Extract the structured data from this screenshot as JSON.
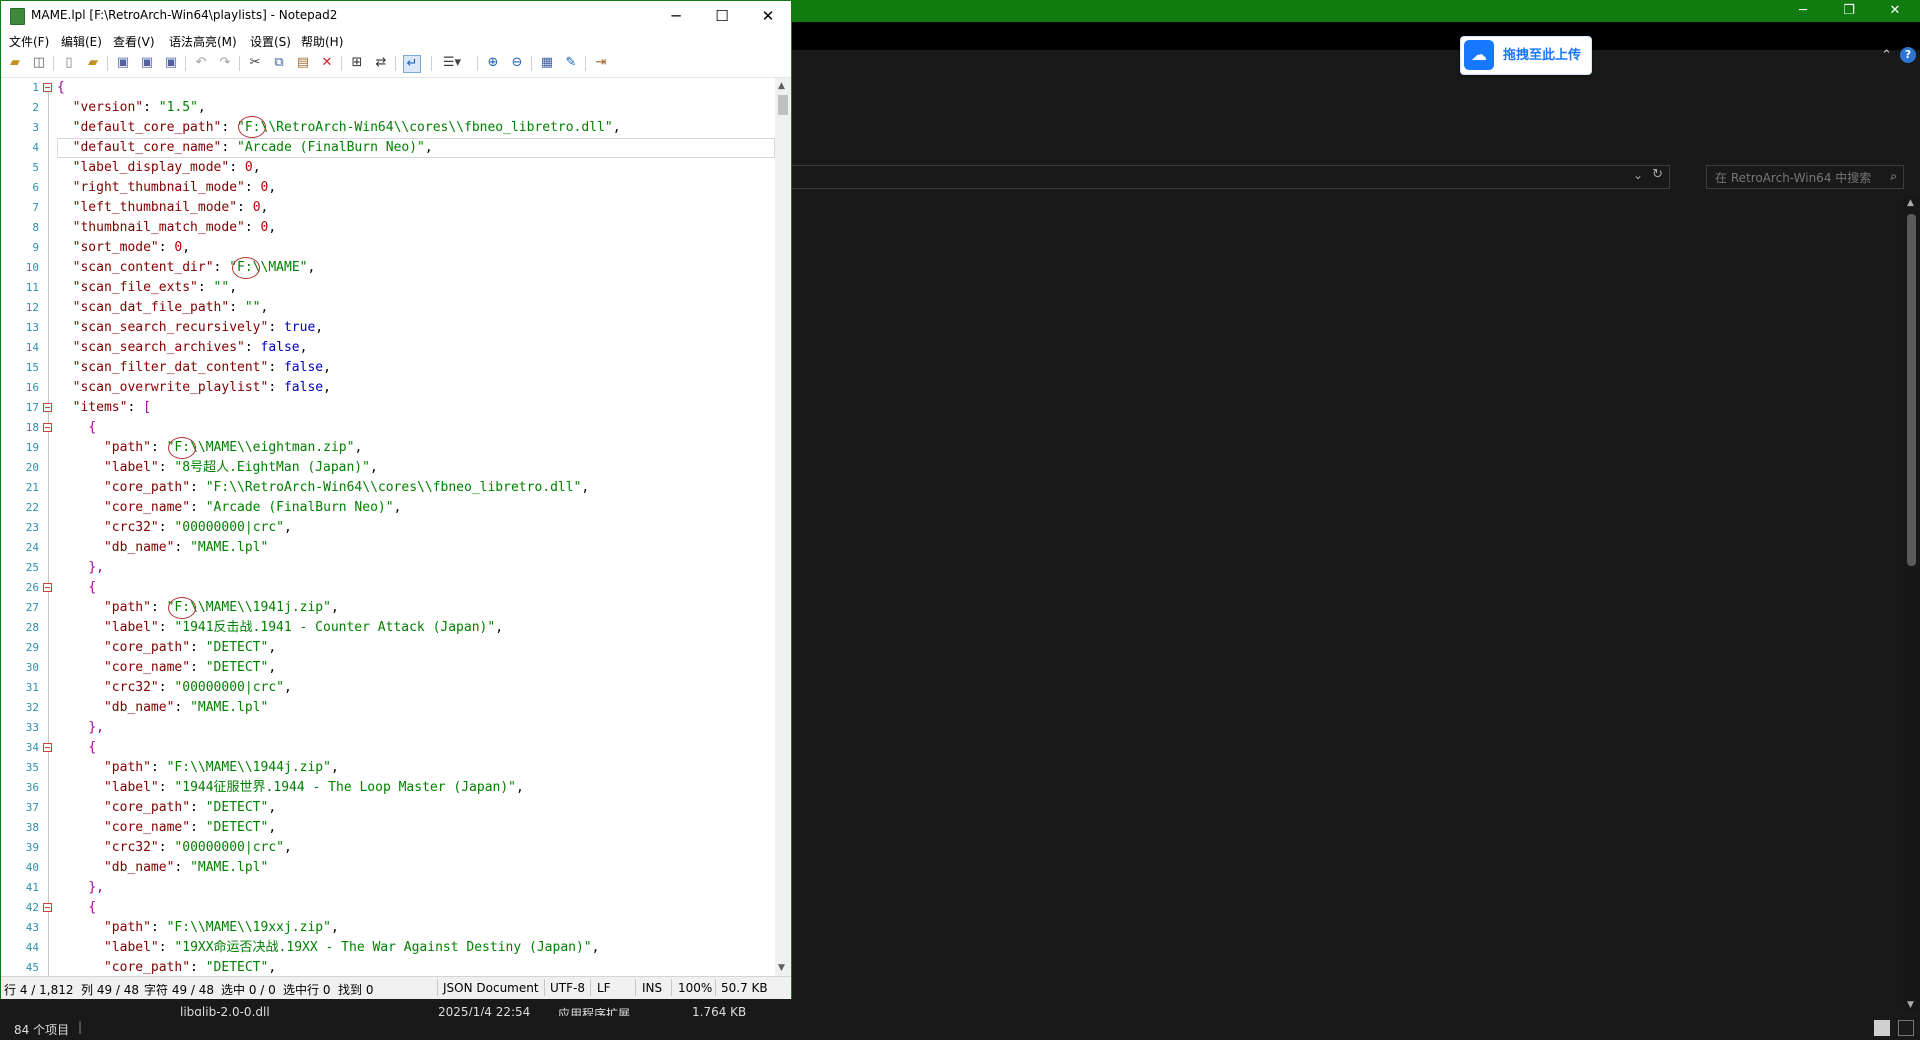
{
  "explorer": {
    "search_placeholder": "在 RetroArch-Win64 中搜索",
    "cloud_upload_label": "拖拽至此上传",
    "help_label": "?",
    "row": {
      "name": "libglib-2.0-0.dll",
      "modified": "2025/1/4 22:54",
      "type": "应用程序扩展",
      "size": "1,764 KB"
    },
    "status": {
      "item_count": "84 个项目",
      "separator": "|"
    }
  },
  "notepad": {
    "title": "MAME.lpl [F:\\RetroArch-Win64\\playlists] - Notepad2",
    "menu": [
      "文件(F)",
      "编辑(E)",
      "查看(V)",
      "语法高亮(M)",
      "设置(S)",
      "帮助(H)"
    ],
    "status": {
      "position": "行 4 / 1,812",
      "column": "列 49 / 48",
      "char": "字符 49 / 48",
      "selection": "选中 0 / 0",
      "selected_lines": "选中行 0",
      "find": "找到 0",
      "syntax": "JSON Document",
      "encoding": "UTF-8",
      "eol": "LF",
      "mode": "INS",
      "zoom": "100%",
      "size": "50.7 KB"
    },
    "lines": [
      {
        "n": "1",
        "t": [
          [
            "br",
            "{"
          ]
        ]
      },
      {
        "n": "2",
        "t": [
          [
            "p",
            "  "
          ],
          [
            "k",
            "\"version\""
          ],
          [
            "p",
            ": "
          ],
          [
            "s",
            "\"1.5\""
          ],
          [
            "p",
            ","
          ]
        ]
      },
      {
        "n": "3",
        "t": [
          [
            "p",
            "  "
          ],
          [
            "k",
            "\"default_core_path\""
          ],
          [
            "p",
            ": "
          ],
          [
            "s",
            "\"F:\\\\RetroArch-Win64\\\\cores\\\\fbneo_libretro.dll\""
          ],
          [
            "p",
            ","
          ]
        ]
      },
      {
        "n": "4",
        "t": [
          [
            "p",
            "  "
          ],
          [
            "k",
            "\"default_core_name\""
          ],
          [
            "p",
            ": "
          ],
          [
            "s",
            "\"Arcade (FinalBurn Neo)\""
          ],
          [
            "p",
            ","
          ]
        ]
      },
      {
        "n": "5",
        "t": [
          [
            "p",
            "  "
          ],
          [
            "k",
            "\"label_display_mode\""
          ],
          [
            "p",
            ": "
          ],
          [
            "n",
            "0"
          ],
          [
            "p",
            ","
          ]
        ]
      },
      {
        "n": "6",
        "t": [
          [
            "p",
            "  "
          ],
          [
            "k",
            "\"right_thumbnail_mode\""
          ],
          [
            "p",
            ": "
          ],
          [
            "n",
            "0"
          ],
          [
            "p",
            ","
          ]
        ]
      },
      {
        "n": "7",
        "t": [
          [
            "p",
            "  "
          ],
          [
            "k",
            "\"left_thumbnail_mode\""
          ],
          [
            "p",
            ": "
          ],
          [
            "n",
            "0"
          ],
          [
            "p",
            ","
          ]
        ]
      },
      {
        "n": "8",
        "t": [
          [
            "p",
            "  "
          ],
          [
            "k",
            "\"thumbnail_match_mode\""
          ],
          [
            "p",
            ": "
          ],
          [
            "n",
            "0"
          ],
          [
            "p",
            ","
          ]
        ]
      },
      {
        "n": "9",
        "t": [
          [
            "p",
            "  "
          ],
          [
            "k",
            "\"sort_mode\""
          ],
          [
            "p",
            ": "
          ],
          [
            "n",
            "0"
          ],
          [
            "p",
            ","
          ]
        ]
      },
      {
        "n": "10",
        "t": [
          [
            "p",
            "  "
          ],
          [
            "k",
            "\"scan_content_dir\""
          ],
          [
            "p",
            ": "
          ],
          [
            "s",
            "\"F:\\\\MAME\""
          ],
          [
            "p",
            ","
          ]
        ]
      },
      {
        "n": "11",
        "t": [
          [
            "p",
            "  "
          ],
          [
            "k",
            "\"scan_file_exts\""
          ],
          [
            "p",
            ": "
          ],
          [
            "s",
            "\"\""
          ],
          [
            "p",
            ","
          ]
        ]
      },
      {
        "n": "12",
        "t": [
          [
            "p",
            "  "
          ],
          [
            "k",
            "\"scan_dat_file_path\""
          ],
          [
            "p",
            ": "
          ],
          [
            "s",
            "\"\""
          ],
          [
            "p",
            ","
          ]
        ]
      },
      {
        "n": "13",
        "t": [
          [
            "p",
            "  "
          ],
          [
            "k",
            "\"scan_search_recursively\""
          ],
          [
            "p",
            ": "
          ],
          [
            "b",
            "true"
          ],
          [
            "p",
            ","
          ]
        ]
      },
      {
        "n": "14",
        "t": [
          [
            "p",
            "  "
          ],
          [
            "k",
            "\"scan_search_archives\""
          ],
          [
            "p",
            ": "
          ],
          [
            "b",
            "false"
          ],
          [
            "p",
            ","
          ]
        ]
      },
      {
        "n": "15",
        "t": [
          [
            "p",
            "  "
          ],
          [
            "k",
            "\"scan_filter_dat_content\""
          ],
          [
            "p",
            ": "
          ],
          [
            "b",
            "false"
          ],
          [
            "p",
            ","
          ]
        ]
      },
      {
        "n": "16",
        "t": [
          [
            "p",
            "  "
          ],
          [
            "k",
            "\"scan_overwrite_playlist\""
          ],
          [
            "p",
            ": "
          ],
          [
            "b",
            "false"
          ],
          [
            "p",
            ","
          ]
        ]
      },
      {
        "n": "17",
        "t": [
          [
            "p",
            "  "
          ],
          [
            "k",
            "\"items\""
          ],
          [
            "p",
            ": "
          ],
          [
            "br",
            "["
          ]
        ]
      },
      {
        "n": "18",
        "t": [
          [
            "p",
            "    "
          ],
          [
            "br",
            "{"
          ]
        ]
      },
      {
        "n": "19",
        "t": [
          [
            "p",
            "      "
          ],
          [
            "k",
            "\"path\""
          ],
          [
            "p",
            ": "
          ],
          [
            "s",
            "\"F:\\\\MAME\\\\eightman.zip\""
          ],
          [
            "p",
            ","
          ]
        ]
      },
      {
        "n": "20",
        "t": [
          [
            "p",
            "      "
          ],
          [
            "k",
            "\"label\""
          ],
          [
            "p",
            ": "
          ],
          [
            "s",
            "\"8号超人.EightMan (Japan)\""
          ],
          [
            "p",
            ","
          ]
        ]
      },
      {
        "n": "21",
        "t": [
          [
            "p",
            "      "
          ],
          [
            "k",
            "\"core_path\""
          ],
          [
            "p",
            ": "
          ],
          [
            "s",
            "\"F:\\\\RetroArch-Win64\\\\cores\\\\fbneo_libretro.dll\""
          ],
          [
            "p",
            ","
          ]
        ]
      },
      {
        "n": "22",
        "t": [
          [
            "p",
            "      "
          ],
          [
            "k",
            "\"core_name\""
          ],
          [
            "p",
            ": "
          ],
          [
            "s",
            "\"Arcade (FinalBurn Neo)\""
          ],
          [
            "p",
            ","
          ]
        ]
      },
      {
        "n": "23",
        "t": [
          [
            "p",
            "      "
          ],
          [
            "k",
            "\"crc32\""
          ],
          [
            "p",
            ": "
          ],
          [
            "s",
            "\"00000000|crc\""
          ],
          [
            "p",
            ","
          ]
        ]
      },
      {
        "n": "24",
        "t": [
          [
            "p",
            "      "
          ],
          [
            "k",
            "\"db_name\""
          ],
          [
            "p",
            ": "
          ],
          [
            "s",
            "\"MAME.lpl\""
          ]
        ]
      },
      {
        "n": "25",
        "t": [
          [
            "p",
            "    "
          ],
          [
            "br",
            "},"
          ]
        ]
      },
      {
        "n": "26",
        "t": [
          [
            "p",
            "    "
          ],
          [
            "br",
            "{"
          ]
        ]
      },
      {
        "n": "27",
        "t": [
          [
            "p",
            "      "
          ],
          [
            "k",
            "\"path\""
          ],
          [
            "p",
            ": "
          ],
          [
            "s",
            "\"F:\\\\MAME\\\\1941j.zip\""
          ],
          [
            "p",
            ","
          ]
        ]
      },
      {
        "n": "28",
        "t": [
          [
            "p",
            "      "
          ],
          [
            "k",
            "\"label\""
          ],
          [
            "p",
            ": "
          ],
          [
            "s",
            "\"1941反击战.1941 - Counter Attack (Japan)\""
          ],
          [
            "p",
            ","
          ]
        ]
      },
      {
        "n": "29",
        "t": [
          [
            "p",
            "      "
          ],
          [
            "k",
            "\"core_path\""
          ],
          [
            "p",
            ": "
          ],
          [
            "s",
            "\"DETECT\""
          ],
          [
            "p",
            ","
          ]
        ]
      },
      {
        "n": "30",
        "t": [
          [
            "p",
            "      "
          ],
          [
            "k",
            "\"core_name\""
          ],
          [
            "p",
            ": "
          ],
          [
            "s",
            "\"DETECT\""
          ],
          [
            "p",
            ","
          ]
        ]
      },
      {
        "n": "31",
        "t": [
          [
            "p",
            "      "
          ],
          [
            "k",
            "\"crc32\""
          ],
          [
            "p",
            ": "
          ],
          [
            "s",
            "\"00000000|crc\""
          ],
          [
            "p",
            ","
          ]
        ]
      },
      {
        "n": "32",
        "t": [
          [
            "p",
            "      "
          ],
          [
            "k",
            "\"db_name\""
          ],
          [
            "p",
            ": "
          ],
          [
            "s",
            "\"MAME.lpl\""
          ]
        ]
      },
      {
        "n": "33",
        "t": [
          [
            "p",
            "    "
          ],
          [
            "br",
            "},"
          ]
        ]
      },
      {
        "n": "34",
        "t": [
          [
            "p",
            "    "
          ],
          [
            "br",
            "{"
          ]
        ]
      },
      {
        "n": "35",
        "t": [
          [
            "p",
            "      "
          ],
          [
            "k",
            "\"path\""
          ],
          [
            "p",
            ": "
          ],
          [
            "s",
            "\"F:\\\\MAME\\\\1944j.zip\""
          ],
          [
            "p",
            ","
          ]
        ]
      },
      {
        "n": "36",
        "t": [
          [
            "p",
            "      "
          ],
          [
            "k",
            "\"label\""
          ],
          [
            "p",
            ": "
          ],
          [
            "s",
            "\"1944征服世界.1944 - The Loop Master (Japan)\""
          ],
          [
            "p",
            ","
          ]
        ]
      },
      {
        "n": "37",
        "t": [
          [
            "p",
            "      "
          ],
          [
            "k",
            "\"core_path\""
          ],
          [
            "p",
            ": "
          ],
          [
            "s",
            "\"DETECT\""
          ],
          [
            "p",
            ","
          ]
        ]
      },
      {
        "n": "38",
        "t": [
          [
            "p",
            "      "
          ],
          [
            "k",
            "\"core_name\""
          ],
          [
            "p",
            ": "
          ],
          [
            "s",
            "\"DETECT\""
          ],
          [
            "p",
            ","
          ]
        ]
      },
      {
        "n": "39",
        "t": [
          [
            "p",
            "      "
          ],
          [
            "k",
            "\"crc32\""
          ],
          [
            "p",
            ": "
          ],
          [
            "s",
            "\"00000000|crc\""
          ],
          [
            "p",
            ","
          ]
        ]
      },
      {
        "n": "40",
        "t": [
          [
            "p",
            "      "
          ],
          [
            "k",
            "\"db_name\""
          ],
          [
            "p",
            ": "
          ],
          [
            "s",
            "\"MAME.lpl\""
          ]
        ]
      },
      {
        "n": "41",
        "t": [
          [
            "p",
            "    "
          ],
          [
            "br",
            "},"
          ]
        ]
      },
      {
        "n": "42",
        "t": [
          [
            "p",
            "    "
          ],
          [
            "br",
            "{"
          ]
        ]
      },
      {
        "n": "43",
        "t": [
          [
            "p",
            "      "
          ],
          [
            "k",
            "\"path\""
          ],
          [
            "p",
            ": "
          ],
          [
            "s",
            "\"F:\\\\MAME\\\\19xxj.zip\""
          ],
          [
            "p",
            ","
          ]
        ]
      },
      {
        "n": "44",
        "t": [
          [
            "p",
            "      "
          ],
          [
            "k",
            "\"label\""
          ],
          [
            "p",
            ": "
          ],
          [
            "s",
            "\"19XX命运否决战.19XX - The War Against Destiny (Japan)\""
          ],
          [
            "p",
            ","
          ]
        ]
      },
      {
        "n": "45",
        "t": [
          [
            "p",
            "      "
          ],
          [
            "k",
            "\"core_path\""
          ],
          [
            "p",
            ": "
          ],
          [
            "s",
            "\"DETECT\""
          ],
          [
            "p",
            ","
          ]
        ]
      }
    ]
  }
}
